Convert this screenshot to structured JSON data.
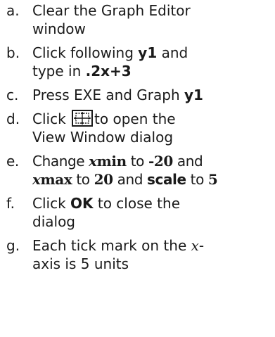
{
  "steps": [
    {
      "marker": "a.",
      "line1": "Clear the Graph Editor",
      "line2": "window"
    },
    {
      "marker": "b.",
      "pre": "Click following ",
      "var": "y1",
      "post": " and",
      "line2_pre": "type in ",
      "expr": ".2x+3"
    },
    {
      "marker": "c.",
      "pre": "Press EXE and Graph ",
      "var": "y1"
    },
    {
      "marker": "d.",
      "pre": "Click ",
      "icon": "view-window-icon",
      "post": "to open the",
      "line2": "View Window dialog"
    },
    {
      "marker": "e.",
      "pre": "Change ",
      "xmin_x": "x",
      "xmin_rest": "min",
      "mid1": " to ",
      "v1": "-20",
      "mid2": " and",
      "xmax_x": "x",
      "xmax_rest": "max",
      "mid3": " to ",
      "v2": "20",
      "mid4": " and ",
      "scale": "scale",
      "mid5": " to ",
      "v3": "5"
    },
    {
      "marker": "f.",
      "pre": "Click ",
      "ok": "OK",
      "post": " to close the",
      "line2": "dialog"
    },
    {
      "marker": "g.",
      "pre": "Each tick mark on the ",
      "xvar": "x",
      "post": "-",
      "line2": "axis is 5 units"
    }
  ]
}
